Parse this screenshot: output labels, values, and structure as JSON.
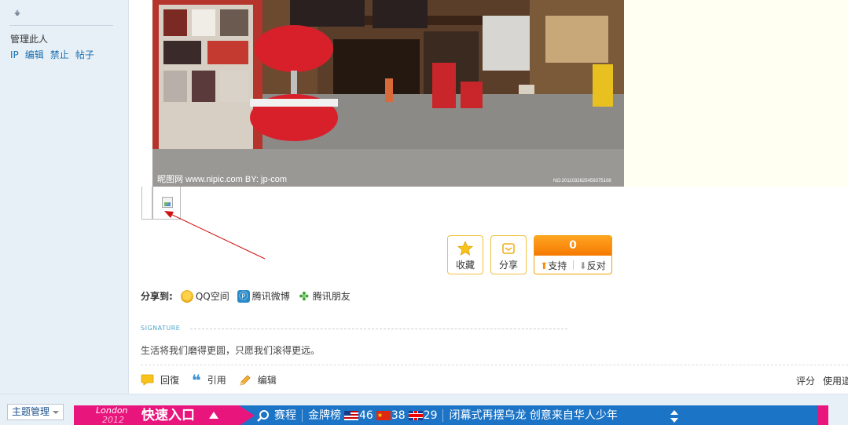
{
  "sidebar": {
    "manage_label": "管理此人",
    "links": [
      "IP",
      "编辑",
      "禁止",
      "帖子"
    ]
  },
  "actions": {
    "favorite": "收藏",
    "share": "分享",
    "vote_count": "0",
    "support": "支持",
    "oppose": "反对"
  },
  "share_to": {
    "label": "分享到:",
    "items": [
      "QQ空间",
      "腾讯微博",
      "腾讯朋友"
    ]
  },
  "signature": {
    "title": "SIGNATURE",
    "text": "生活将我们磨得更圆，只愿我们滚得更远。"
  },
  "reply_actions": {
    "reply": "回復",
    "quote": "引用",
    "edit": "编辑",
    "rate": "评分",
    "use": "使用道"
  },
  "bottom": {
    "topic_manage": "主题管理",
    "banner": {
      "london": "London",
      "year": "2012",
      "quick_entry": "快速入口",
      "schedule": "赛程",
      "medal_table": "金牌榜",
      "us_count": "46",
      "cn_count": "38",
      "uk_count": "29",
      "news": "闭幕式再摆乌龙 创意来自华人少年"
    }
  },
  "colors": {
    "sidebar_bg": "#e8f0f7",
    "link": "#1a6fb0",
    "vote_orange": "#ff8a00",
    "banner_blue": "#1c74c6",
    "banner_pink": "#e8157d"
  }
}
